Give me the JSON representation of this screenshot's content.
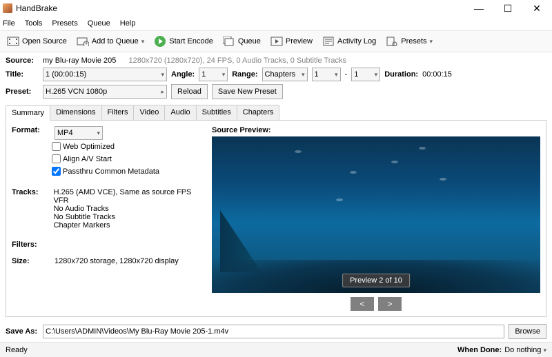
{
  "window": {
    "title": "HandBrake"
  },
  "menu": {
    "file": "File",
    "tools": "Tools",
    "presets": "Presets",
    "queue": "Queue",
    "help": "Help"
  },
  "toolbar": {
    "open_source": "Open Source",
    "add_to_queue": "Add to Queue",
    "start_encode": "Start Encode",
    "queue": "Queue",
    "preview": "Preview",
    "activity_log": "Activity Log",
    "presets": "Presets"
  },
  "source": {
    "label": "Source:",
    "name": "my Blu-ray Movie 205",
    "details": "1280x720 (1280x720), 24 FPS, 0 Audio Tracks, 0 Subtitle Tracks"
  },
  "title_row": {
    "title_label": "Title:",
    "title_value": "1 (00:00:15)",
    "angle_label": "Angle:",
    "angle_value": "1",
    "range_label": "Range:",
    "range_mode": "Chapters",
    "range_from": "1",
    "range_dash": "-",
    "range_to": "1",
    "duration_label": "Duration:",
    "duration_value": "00:00:15"
  },
  "preset_row": {
    "label": "Preset:",
    "value": "H.265 VCN 1080p",
    "reload": "Reload",
    "save_new": "Save New Preset"
  },
  "tabs": {
    "summary": "Summary",
    "dimensions": "Dimensions",
    "filters": "Filters",
    "video": "Video",
    "audio": "Audio",
    "subtitles": "Subtitles",
    "chapters": "Chapters"
  },
  "summary": {
    "format_label": "Format:",
    "format_value": "MP4",
    "web_optimized": "Web Optimized",
    "align_av": "Align A/V Start",
    "passthru": "Passthru Common Metadata",
    "tracks_label": "Tracks:",
    "tracks_video": "H.265 (AMD VCE), Same as source FPS VFR",
    "tracks_audio": "No Audio Tracks",
    "tracks_sub": "No Subtitle Tracks",
    "tracks_chapters": "Chapter Markers",
    "filters_label": "Filters:",
    "size_label": "Size:",
    "size_value": "1280x720 storage, 1280x720 display",
    "preview_header": "Source Preview:",
    "preview_pill": "Preview 2 of 10",
    "prev": "<",
    "next": ">"
  },
  "save": {
    "label": "Save As:",
    "path": "C:\\Users\\ADMIN\\Videos\\My Blu-Ray Movie 205-1.m4v",
    "browse": "Browse"
  },
  "status": {
    "ready": "Ready",
    "when_done_label": "When Done:",
    "when_done_value": "Do nothing"
  }
}
